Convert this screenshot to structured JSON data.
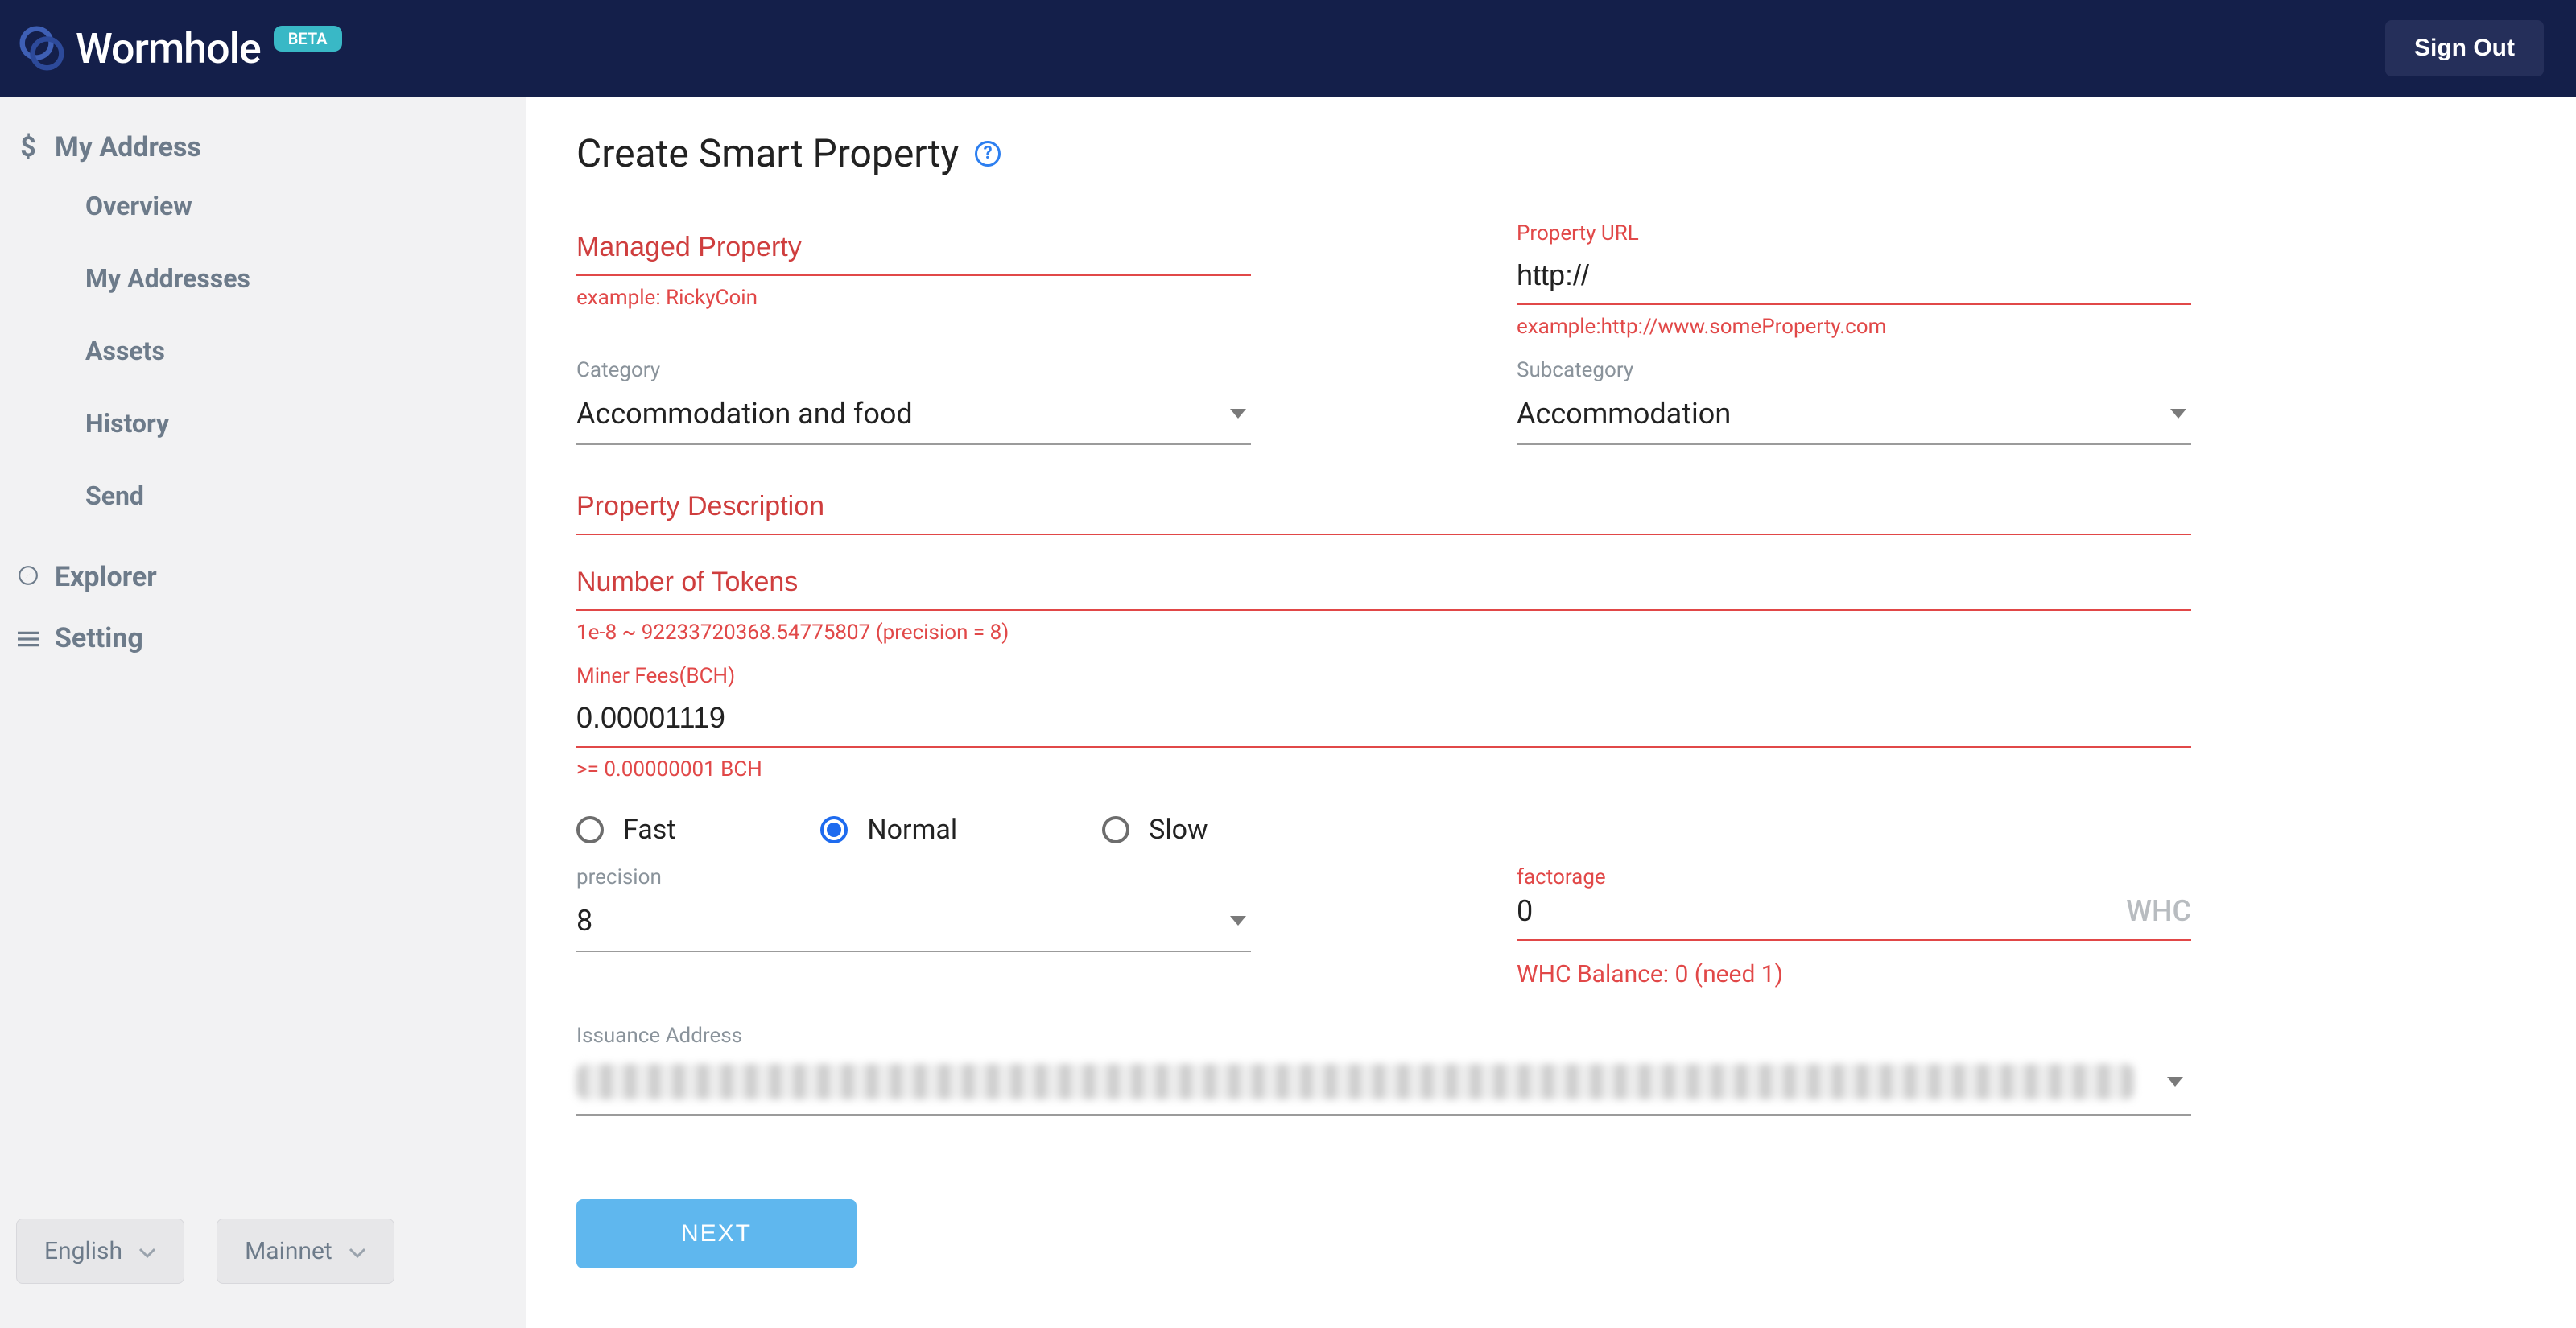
{
  "header": {
    "logo_text": "Wormhole",
    "beta": "BETA",
    "signout": "Sign Out"
  },
  "sidebar": {
    "section1": {
      "title": "My Address",
      "items": [
        "Overview",
        "My Addresses",
        "Assets",
        "History",
        "Send"
      ]
    },
    "explorer": "Explorer",
    "setting": "Setting",
    "lang": "English",
    "net": "Mainnet"
  },
  "page": {
    "title": "Create Smart Property"
  },
  "form": {
    "managed_label": "Managed Property",
    "managed_hint": "example: RickyCoin",
    "url_label": "Property URL",
    "url_value": "http://",
    "url_hint": "example:http://www.someProperty.com",
    "category_label": "Category",
    "category_value": "Accommodation and food",
    "subcategory_label": "Subcategory",
    "subcategory_value": "Accommodation",
    "desc_label": "Property Description",
    "tokens_label": "Number of Tokens",
    "tokens_hint": "1e-8 ~ 92233720368.54775807 (precision = 8)",
    "miner_label": "Miner Fees(BCH)",
    "miner_value": "0.00001119",
    "miner_hint": ">= 0.00000001 BCH",
    "speed": {
      "fast": "Fast",
      "normal": "Normal",
      "slow": "Slow"
    },
    "precision_label": "precision",
    "precision_value": "8",
    "factorage_label": "factorage",
    "factorage_value": "0",
    "factorage_unit": "WHC",
    "balance": "WHC Balance: 0 (need 1)",
    "issuance_label": "Issuance Address",
    "next": "NEXT"
  }
}
